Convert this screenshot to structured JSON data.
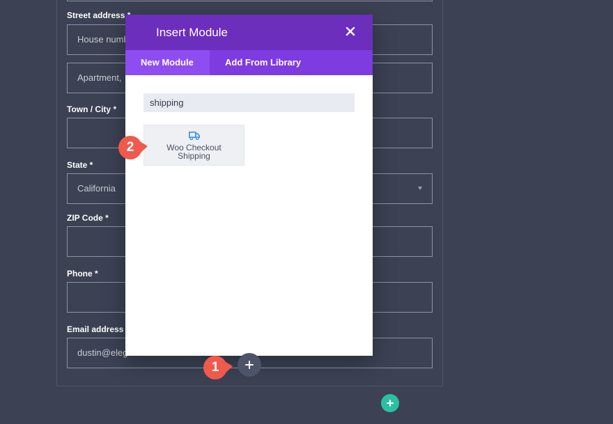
{
  "form": {
    "street_label": "Street address *",
    "street_placeholder_1": "House numb",
    "street_placeholder_2": "Apartment,",
    "town_label": "Town / City *",
    "state_label": "State *",
    "state_value": "California",
    "zip_label": "ZIP Code *",
    "phone_label": "Phone *",
    "email_label": "Email address *",
    "email_value": "dustin@elegantthemes.com"
  },
  "modal": {
    "title": "Insert Module",
    "tabs": [
      {
        "label": "New Module",
        "active": true
      },
      {
        "label": "Add From Library",
        "active": false
      }
    ],
    "search_value": "shipping",
    "modules": [
      {
        "label_line1": "Woo Checkout",
        "label_line2": "Shipping",
        "icon": "truck-icon"
      }
    ]
  },
  "callouts": [
    {
      "number": "1"
    },
    {
      "number": "2"
    }
  ],
  "colors": {
    "header": "#6c2ebd",
    "tabs": "#7d3be0",
    "callout": "#ef5a4c",
    "add_green": "#2cc0a3",
    "icon_blue": "#3a8ee6"
  }
}
